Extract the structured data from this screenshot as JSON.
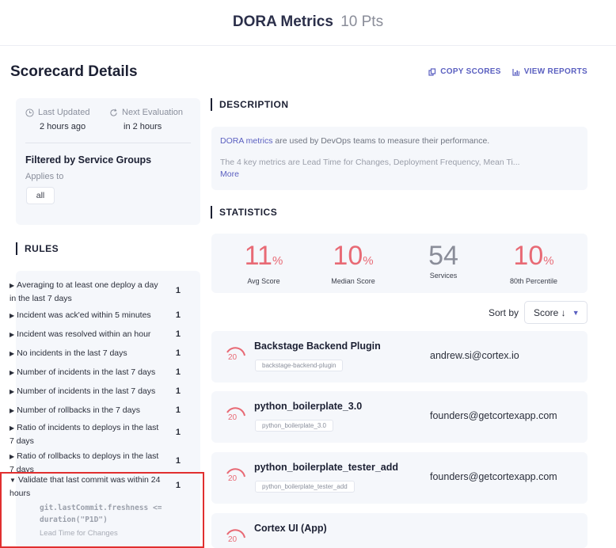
{
  "header": {
    "title": "DORA Metrics",
    "points": "10 Pts"
  },
  "scorecard": {
    "title": "Scorecard Details",
    "copy_scores": "COPY SCORES",
    "view_reports": "VIEW REPORTS"
  },
  "info": {
    "last_updated_label": "Last Updated",
    "last_updated_value": "2 hours ago",
    "next_eval_label": "Next Evaluation",
    "next_eval_value": "in 2 hours",
    "filter_title": "Filtered by Service Groups",
    "applies_to": "Applies to",
    "group_chip": "all"
  },
  "rules": {
    "heading": "RULES",
    "items": [
      {
        "text": "Averaging to at least one deploy a day in the last 7 days",
        "count": "1"
      },
      {
        "text": "Incident was ack'ed within 5 minutes",
        "count": "1"
      },
      {
        "text": "Incident was resolved within an hour",
        "count": "1"
      },
      {
        "text": "No incidents in the last 7 days",
        "count": "1"
      },
      {
        "text": "Number of incidents in the last 7 days",
        "count": "1"
      },
      {
        "text": "Number of incidents in the last 7 days",
        "count": "1"
      },
      {
        "text": "Number of rollbacks in the 7 days",
        "count": "1"
      },
      {
        "text": "Ratio of incidents to deploys in the last 7 days",
        "count": "1"
      },
      {
        "text": "Ratio of rollbacks to deploys in the last 7 days",
        "count": "1"
      },
      {
        "text": "Validate that last commit was within 24 hours",
        "count": "1"
      }
    ],
    "expanded_code_1": "git.lastCommit.freshness <=",
    "expanded_code_2": "duration(\"P1D\")",
    "expanded_category": "Lead Time for Changes"
  },
  "description": {
    "heading": "DESCRIPTION",
    "link": "DORA metrics",
    "line1_rest": " are used by DevOps teams to measure their performance.",
    "line2": "The 4 key metrics are Lead Time for Changes, Deployment Frequency, Mean Ti...",
    "more": "More"
  },
  "statistics": {
    "heading": "STATISTICS",
    "avg_score": "11",
    "avg_score_label": "Avg Score",
    "median_score": "10",
    "median_score_label": "Median Score",
    "services": "54",
    "services_label": "Services",
    "percentile": "10",
    "percentile_label": "80th Percentile",
    "pct_sign": "%"
  },
  "sort": {
    "label": "Sort by",
    "value": "Score ↓"
  },
  "services": [
    {
      "name": "Backstage Backend Plugin",
      "tag": "backstage-backend-plugin",
      "owner": "andrew.si@cortex.io",
      "score": "20"
    },
    {
      "name": "python_boilerplate_3.0",
      "tag": "python_boilerplate_3.0",
      "owner": "founders@getcortexapp.com",
      "score": "20"
    },
    {
      "name": "python_boilerplate_tester_add",
      "tag": "python_boilerplate_tester_add",
      "owner": "founders@getcortexapp.com",
      "score": "20"
    },
    {
      "name": "Cortex UI (App)",
      "tag": "",
      "owner": "",
      "score": "20"
    }
  ],
  "colors": {
    "accent": "#5a5fc0",
    "score_red": "#e86a75",
    "highlight": "#e12f2f"
  }
}
